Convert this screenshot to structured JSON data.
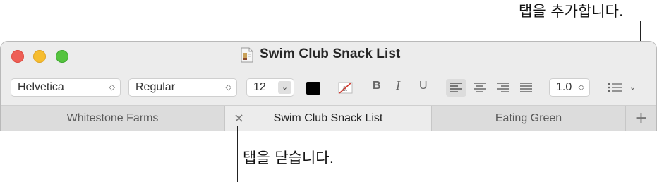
{
  "callouts": {
    "add_tab": "탭을 추가합니다.",
    "close_tab": "탭을 닫습니다."
  },
  "window": {
    "title": "Swim Club Snack List",
    "doc_icon": "text-document-icon"
  },
  "toolbar": {
    "font_family": "Helvetica",
    "font_style": "Regular",
    "font_size": "12",
    "text_color": "#000000",
    "bold_label": "B",
    "italic_label": "I",
    "underline_label": "U",
    "line_spacing": "1.0",
    "popup_chevron": "⌃⌄",
    "stepper_chevron": "⌄",
    "list_chevron": "⌄"
  },
  "tabs": {
    "items": [
      {
        "label": "Whitestone Farms",
        "active": false
      },
      {
        "label": "Swim Club Snack List",
        "active": true
      },
      {
        "label": "Eating Green",
        "active": false
      }
    ],
    "close_glyph": "×",
    "add_glyph": "+"
  }
}
